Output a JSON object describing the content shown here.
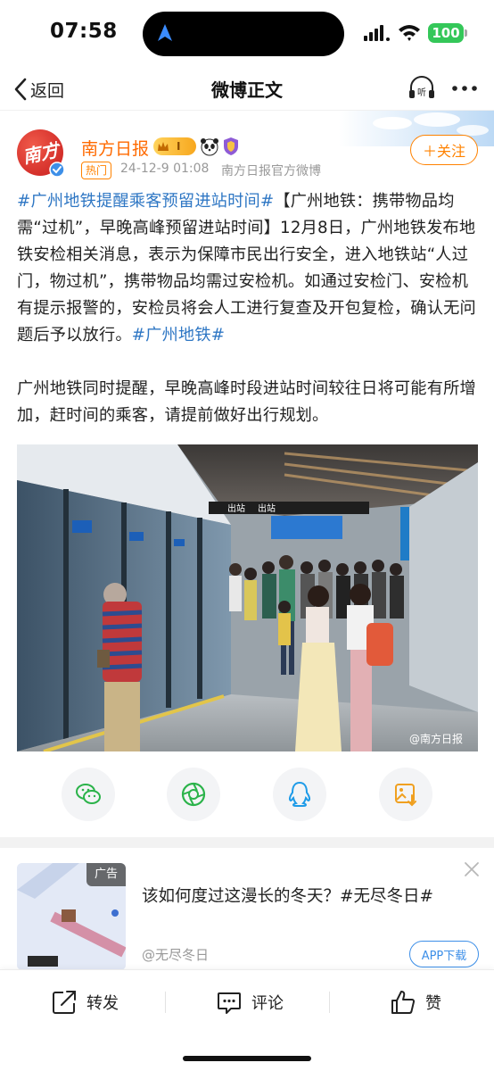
{
  "status_bar": {
    "time": "07:58",
    "battery": "100"
  },
  "nav": {
    "back_label": "返回",
    "title": "微博正文"
  },
  "author": {
    "name": "南方日报",
    "avatar_text": "南方",
    "avatar_plus": "+",
    "vip_level": "I",
    "hot_tag": "热门",
    "time": "24-12-9 01:08",
    "source": "南方日报官方微博",
    "follow_label": "＋关注"
  },
  "post": {
    "topic1": "#广州地铁提醒乘客预留进站时间#",
    "body1": "【广州地铁：携带物品均需“过机”，早晚高峰预留进站时间】12月8日，广州地铁发布地铁安检相关消息，表示为保障市民出行安全，进入地铁站“人过门，物过机”，携带物品均需过安检机。如通过安检门、安检机有提示报警的，安检员将会人工进行复查及开包复检，确认无问题后予以放行。",
    "topic2": "#广州地铁#",
    "body2": "广州地铁同时提醒，早晚高峰时段进站时间较往日将可能有所增加，赶时间的乘客，请提前做好出行规划。",
    "image_watermark": "@南方日报",
    "sign_exit": "出站",
    "sign_left": "出站"
  },
  "share": {
    "items": [
      "wechat-icon",
      "moments-icon",
      "qq-icon",
      "save-image-icon"
    ]
  },
  "ad": {
    "label": "广告",
    "title": "该如何度过这漫长的冬天？#无尽冬日#",
    "source": "@无尽冬日",
    "download_label": "APP下载"
  },
  "actions": {
    "repost": "转发",
    "comment": "评论",
    "like": "赞"
  },
  "colors": {
    "accent": "#ff8200",
    "link": "#2f77c4",
    "battery": "#34c759",
    "ad_button": "#3d8fe8"
  }
}
